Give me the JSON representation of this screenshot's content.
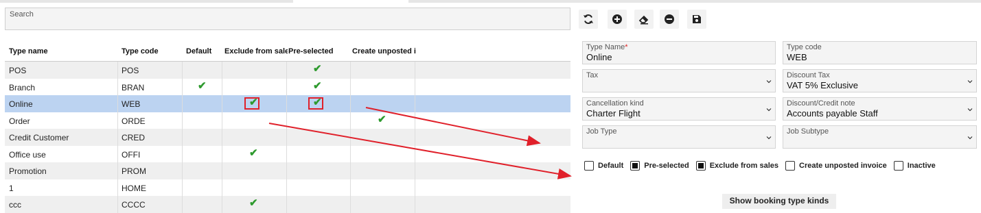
{
  "search": {
    "placeholder": "Search"
  },
  "table": {
    "columns": [
      "Type name",
      "Type code",
      "Default",
      "Exclude from sales",
      "Pre-selected",
      "Create unposted i"
    ],
    "rows": [
      {
        "name": "POS",
        "code": "POS",
        "default": false,
        "exclude": false,
        "preselected": true,
        "unposted": false
      },
      {
        "name": "Branch",
        "code": "BRAN",
        "default": true,
        "exclude": false,
        "preselected": true,
        "unposted": false
      },
      {
        "name": "Online",
        "code": "WEB",
        "default": false,
        "exclude": true,
        "preselected": true,
        "unposted": false,
        "selected": true
      },
      {
        "name": "Order",
        "code": "ORDE",
        "default": false,
        "exclude": false,
        "preselected": false,
        "unposted": true
      },
      {
        "name": "Credit Customer",
        "code": "CRED",
        "default": false,
        "exclude": false,
        "preselected": false,
        "unposted": false
      },
      {
        "name": "Office use",
        "code": "OFFI",
        "default": false,
        "exclude": true,
        "preselected": false,
        "unposted": false
      },
      {
        "name": "Promotion",
        "code": "PROM",
        "default": false,
        "exclude": false,
        "preselected": false,
        "unposted": false
      },
      {
        "name": "1",
        "code": "HOME",
        "default": false,
        "exclude": false,
        "preselected": false,
        "unposted": false
      },
      {
        "name": "ccc",
        "code": "CCCC",
        "default": false,
        "exclude": true,
        "preselected": false,
        "unposted": false
      }
    ]
  },
  "toolbar": {
    "buttons": [
      "refresh-icon",
      "add-circle-icon",
      "eraser-icon",
      "remove-circle-icon",
      "save-icon"
    ]
  },
  "form": {
    "type_name": {
      "label": "Type Name",
      "required": "*",
      "value": "Online"
    },
    "type_code": {
      "label": "Type code",
      "value": "WEB"
    },
    "tax": {
      "label": "Tax",
      "value": ""
    },
    "discount_tax": {
      "label": "Discount Tax",
      "value": "VAT 5% Exclusive"
    },
    "cancellation_kind": {
      "label": "Cancellation kind",
      "value": "Charter Flight"
    },
    "discount_credit_note": {
      "label": "Discount/Credit note",
      "value": "Accounts payable Staff"
    },
    "job_type": {
      "label": "Job Type",
      "value": ""
    },
    "job_subtype": {
      "label": "Job Subtype",
      "value": ""
    },
    "checkboxes": [
      {
        "label": "Default",
        "checked": false
      },
      {
        "label": "Pre-selected",
        "checked": true
      },
      {
        "label": "Exclude from sales",
        "checked": true
      },
      {
        "label": "Create unposted invoice",
        "checked": false
      },
      {
        "label": "Inactive",
        "checked": false
      }
    ],
    "show_button": "Show booking type kinds"
  },
  "colors": {
    "check": "#2e9a2e",
    "selected_row": "#bcd3f1",
    "annotation": "#e0202a"
  }
}
